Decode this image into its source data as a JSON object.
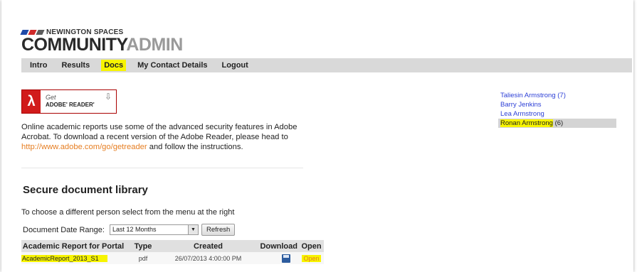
{
  "logo": {
    "org_name": "NEWINGTON SPACES",
    "product_left": "COMMUNITY",
    "product_right": "ADMIN",
    "stripe_colors": [
      "#1e4aa8",
      "#d02a2a",
      "#5d5d5d"
    ]
  },
  "nav": {
    "items": [
      {
        "label": "Intro",
        "active": false
      },
      {
        "label": "Results",
        "active": false
      },
      {
        "label": "Docs",
        "active": true
      },
      {
        "label": "My Contact Details",
        "active": false
      },
      {
        "label": "Logout",
        "active": false
      }
    ]
  },
  "acrobat_badge": {
    "get": "Get",
    "name": "ADOBE' READER'"
  },
  "info": {
    "text_before": "Online academic reports use some of the advanced security features in Adobe Acrobat. To download a recent version of the Adobe Reader, please head to ",
    "link": "http://www.adobe.com/go/getreader",
    "text_after": " and follow the instructions."
  },
  "library": {
    "title": "Secure document library",
    "hint": "To choose a different person select from the menu at the right",
    "date_range_label": "Document Date Range:",
    "date_range_value": "Last 12 Months",
    "refresh_label": "Refresh",
    "columns": [
      "Academic Report for Portal",
      "Type",
      "Created",
      "Download",
      "Open"
    ],
    "rows": [
      {
        "name": "AcademicReport_2013_S1",
        "type": "pdf",
        "created": "26/07/2013 4:00:00 PM",
        "open": "Open"
      }
    ]
  },
  "persons": [
    {
      "name": "Taliesin Armstrong",
      "count": "(7)",
      "selected": false
    },
    {
      "name": "Barry Jenkins",
      "count": "",
      "selected": false
    },
    {
      "name": "Lea Armstrong",
      "count": "",
      "selected": false
    },
    {
      "name": "Ronan Armstrong",
      "count": "(6)",
      "selected": true
    }
  ],
  "colors": {
    "highlight": "#f7f400",
    "nav_bg": "#d9d9d9",
    "link": "#2c3fd6",
    "acrobat_red": "#d11b1b"
  }
}
